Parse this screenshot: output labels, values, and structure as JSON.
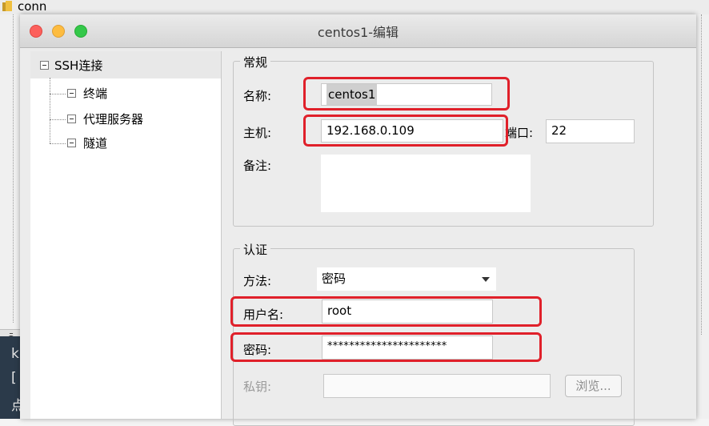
{
  "background_app": {
    "title": "conn",
    "tab_char": "ā",
    "terminal_chars": [
      "k",
      "[",
      "点"
    ]
  },
  "window": {
    "title": "centos1-编辑"
  },
  "tree": {
    "root": "SSH连接",
    "children": [
      "终端",
      "代理服务器",
      "隧道"
    ]
  },
  "general": {
    "group_title": "常规",
    "name_label": "名称:",
    "name_value": "centos1",
    "host_label": "主机:",
    "host_value": "192.168.0.109",
    "port_label": "端口:",
    "port_value": "22",
    "note_label": "备注:",
    "note_value": ""
  },
  "auth": {
    "group_title": "认证",
    "method_label": "方法:",
    "method_value": "密码",
    "username_label": "用户名:",
    "username_value": "root",
    "password_label": "密码:",
    "password_value": "**********************",
    "privkey_label": "私钥:",
    "privkey_value": "",
    "browse_label": "浏览..."
  },
  "colors": {
    "highlight_box": "#e0202a"
  }
}
